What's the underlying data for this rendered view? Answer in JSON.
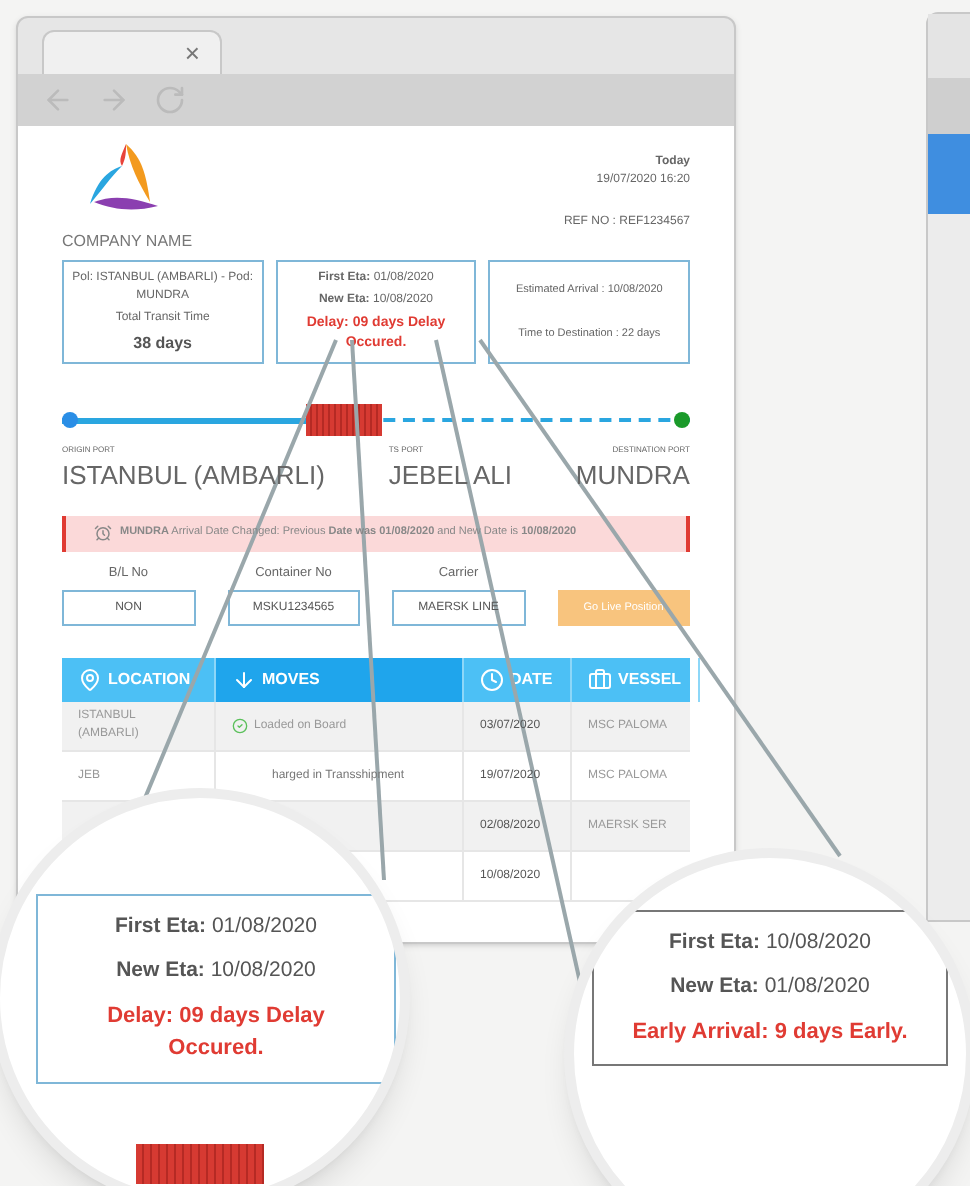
{
  "browser": {
    "tab_close": "×"
  },
  "header": {
    "company_name": "COMPANY NAME",
    "today_label": "Today",
    "today_value": "19/07/2020 16:20",
    "ref": "REF NO : REF1234567"
  },
  "summary": {
    "route": "Pol: ISTANBUL (AMBARLI) - Pod: MUNDRA",
    "transit_label": "Total Transit Time",
    "transit_value": "38 days",
    "eta": {
      "first_label": "First Eta:",
      "first_value": "01/08/2020",
      "new_label": "New Eta:",
      "new_value": "10/08/2020",
      "status": "Delay: 09 days Delay Occured."
    },
    "estimated_arrival": "Estimated Arrival : 10/08/2020",
    "time_to_destination": "Time to Destination : 22 days"
  },
  "route_progress": {
    "level": 0.45
  },
  "ports": [
    {
      "label": "ORIGIN PORT",
      "name": "ISTANBUL (AMBARLI)"
    },
    {
      "label": "TS PORT",
      "name": "JEBEL ALI"
    },
    {
      "label": "DESTINATION PORT",
      "name": "MUNDRA"
    }
  ],
  "alert": "**MUNDRA** Arrival Date Changed: Previous **Date was 01/08/2020** and New Date is **10/08/2020**",
  "fields": [
    {
      "label": "B/L No",
      "value": "NON"
    },
    {
      "label": "Container No",
      "value": "MSKU1234565"
    },
    {
      "label": "Carrier",
      "value": "MAERSK LINE"
    }
  ],
  "live_button": "Go Live Position",
  "table": {
    "columns": [
      {
        "kind": "pin",
        "label": "LOCATION"
      },
      {
        "kind": "down",
        "label": "MOVES"
      },
      {
        "kind": "clock",
        "label": "DATE"
      },
      {
        "kind": "bag",
        "label": "VESSEL"
      }
    ],
    "rows": [
      {
        "location": "ISTANBUL (AMBARLI)",
        "move": "Loaded on Board",
        "done": true,
        "date": "03/07/2020",
        "vessel": "MSC PALOMA"
      },
      {
        "location": "JEB",
        "move": "harged in Transshipment",
        "done": false,
        "date": "19/07/2020",
        "vessel": "MSC PALOMA"
      },
      {
        "location": "",
        "move": "",
        "done": false,
        "date": "02/08/2020",
        "vessel": "MAERSK SER"
      },
      {
        "location": "",
        "move": "",
        "done": false,
        "date": "10/08/2020",
        "vessel": ""
      }
    ]
  },
  "magnifiers": [
    {
      "first_label": "First Eta:",
      "first_value": "01/08/2020",
      "new_label": "New Eta:",
      "new_value": "10/08/2020",
      "status": "Delay: 09 days Delay Occured.",
      "container": true
    },
    {
      "first_label": "First Eta:",
      "first_value": "10/08/2020",
      "new_label": "New Eta:",
      "new_value": "01/08/2020",
      "status": "Early Arrival: 9 days Early.",
      "container": false
    }
  ]
}
